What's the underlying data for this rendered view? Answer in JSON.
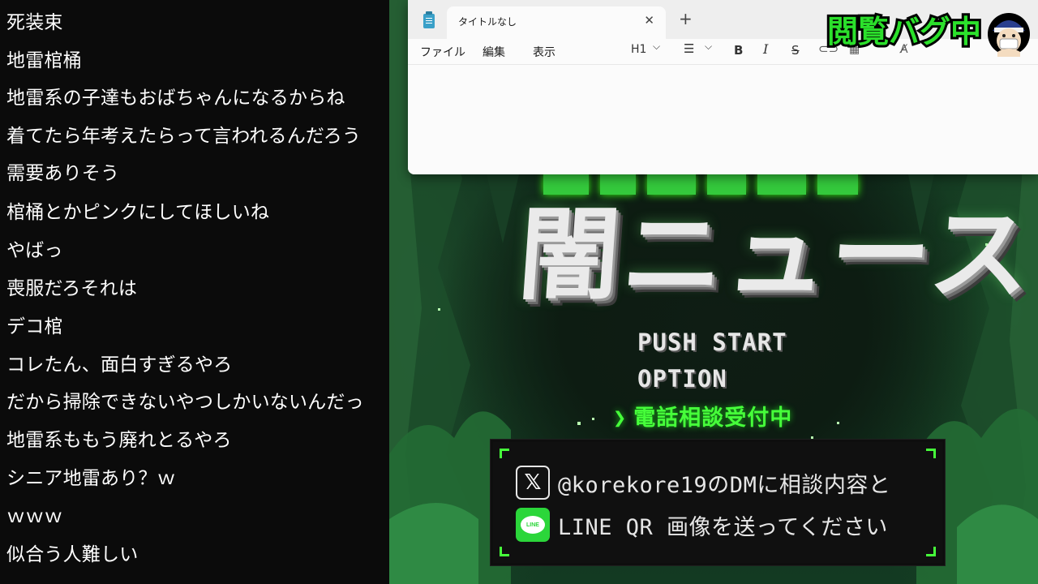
{
  "comments": [
    "死装束",
    "地雷棺桶",
    "地雷系の子達もおばちゃんになるからね",
    "着てたら年考えたらって言われるんだろう",
    "需要ありそう",
    "棺桶とかピンクにしてほしいね",
    "やばっ",
    "喪服だろそれは",
    "デコ棺",
    "コレたん、面白すぎるやろ",
    "だから掃除できないやつしかいないんだっ",
    "地雷系ももう廃れとるやろ",
    "シニア地雷あり？ｗ",
    "ｗｗｗ",
    "似合う人難しい"
  ],
  "notepad": {
    "tab_title": "タイトルなし",
    "close_glyph": "✕",
    "new_tab_glyph": "+",
    "menu": {
      "file": "ファイル",
      "edit": "編集",
      "view": "表示"
    },
    "toolbar": {
      "heading": "H1",
      "chevron": "⌵",
      "list": "☰",
      "bold": "B",
      "italic": "I",
      "strike": "S",
      "link": "⊂⊃",
      "table": "▦",
      "clear": "A̸"
    },
    "app_icon": "notepad-icon"
  },
  "game": {
    "logo": "闇ニュース",
    "menu": {
      "start": "PUSH START",
      "option": "OPTION",
      "phone_arrow": "❯",
      "phone": "電話相談受付中"
    },
    "info": {
      "line1": "@korekore19のDMに相談内容と",
      "line2": "LINE QR 画像を送ってください",
      "x_icon": "𝕏",
      "line_icon_label": "LINE"
    },
    "accent_color": "#46ff3a"
  },
  "badge": {
    "text": "閲覧バグ中",
    "avatar": "masked-character-avatar"
  }
}
